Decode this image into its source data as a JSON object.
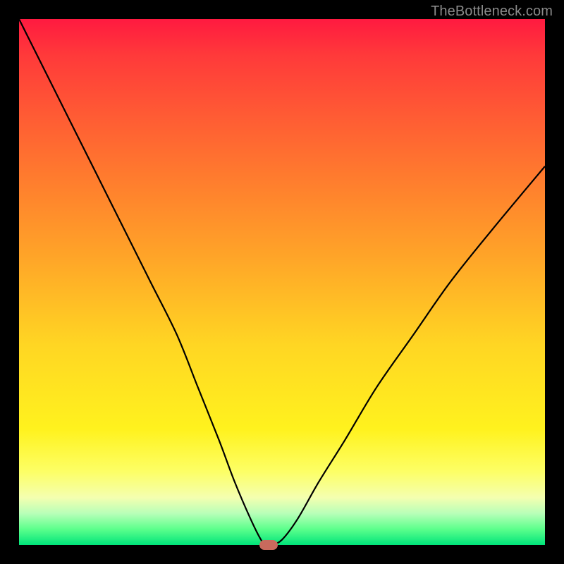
{
  "watermark": "TheBottleneck.com",
  "chart_data": {
    "type": "line",
    "title": "",
    "xlabel": "",
    "ylabel": "",
    "xlim": [
      0,
      100
    ],
    "ylim": [
      0,
      100
    ],
    "curve": [
      {
        "x": 0,
        "y": 100
      },
      {
        "x": 5,
        "y": 90
      },
      {
        "x": 10,
        "y": 80
      },
      {
        "x": 15,
        "y": 70
      },
      {
        "x": 20,
        "y": 60
      },
      {
        "x": 25,
        "y": 50
      },
      {
        "x": 30,
        "y": 40
      },
      {
        "x": 34,
        "y": 30
      },
      {
        "x": 38,
        "y": 20
      },
      {
        "x": 41,
        "y": 12
      },
      {
        "x": 44,
        "y": 5
      },
      {
        "x": 46,
        "y": 1
      },
      {
        "x": 47,
        "y": 0
      },
      {
        "x": 48,
        "y": 0
      },
      {
        "x": 50,
        "y": 1
      },
      {
        "x": 53,
        "y": 5
      },
      {
        "x": 57,
        "y": 12
      },
      {
        "x": 62,
        "y": 20
      },
      {
        "x": 68,
        "y": 30
      },
      {
        "x": 75,
        "y": 40
      },
      {
        "x": 82,
        "y": 50
      },
      {
        "x": 90,
        "y": 60
      },
      {
        "x": 100,
        "y": 72
      }
    ],
    "optimum_marker": {
      "x": 47.5,
      "y": 0
    },
    "gradient_stops": [
      {
        "pos": 0,
        "color": "#ff1a40"
      },
      {
        "pos": 7,
        "color": "#ff3a3a"
      },
      {
        "pos": 18,
        "color": "#ff5a34"
      },
      {
        "pos": 30,
        "color": "#ff7b2e"
      },
      {
        "pos": 45,
        "color": "#ffa428"
      },
      {
        "pos": 62,
        "color": "#ffd623"
      },
      {
        "pos": 78,
        "color": "#fff21e"
      },
      {
        "pos": 86,
        "color": "#fdff65"
      },
      {
        "pos": 91,
        "color": "#f4ffb0"
      },
      {
        "pos": 94,
        "color": "#b8ffb8"
      },
      {
        "pos": 97,
        "color": "#5cff8c"
      },
      {
        "pos": 100,
        "color": "#00e47a"
      }
    ]
  }
}
